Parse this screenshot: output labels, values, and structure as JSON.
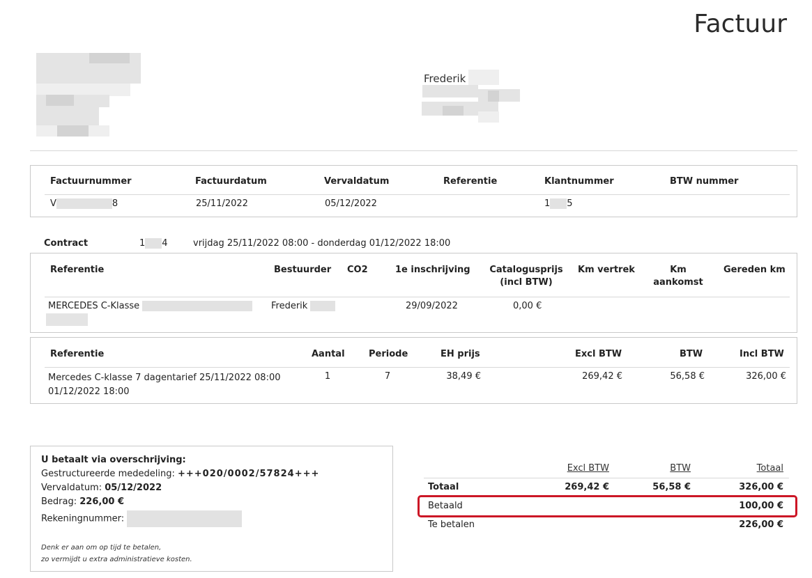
{
  "document": {
    "title": "Factuur"
  },
  "recipient": {
    "first_name": "Frederik"
  },
  "invoice_meta": {
    "headers": [
      "Factuurnummer",
      "Factuurdatum",
      "Vervaldatum",
      "Referentie",
      "Klantnummer",
      "BTW nummer"
    ],
    "factuurnummer_start": "V",
    "factuurnummer_end": "8",
    "factuurdatum": "25/11/2022",
    "vervaldatum": "05/12/2022",
    "klantnummer_start": "1",
    "klantnummer_end": "5"
  },
  "contract": {
    "label": "Contract",
    "number_start": "1",
    "number_end": "4",
    "period": "vrijdag 25/11/2022 08:00 - donderdag 01/12/2022 18:00"
  },
  "vehicle_table": {
    "headers": {
      "referentie": "Referentie",
      "bestuurder": "Bestuurder",
      "co2": "CO2",
      "inschrijving": "1e inschrijving",
      "catalogusprijs_1": "Catalogusprijs",
      "catalogusprijs_2": "(incl BTW)",
      "km_vertrek": "Km vertrek",
      "km_aankomst_1": "Km",
      "km_aankomst_2": "aankomst",
      "gereden_km": "Gereden km"
    },
    "row": {
      "referentie": "MERCEDES C-Klasse",
      "bestuurder": "Frederik",
      "inschrijving": "29/09/2022",
      "catalogusprijs": "0,00 €"
    }
  },
  "lines_table": {
    "headers": {
      "referentie": "Referentie",
      "aantal": "Aantal",
      "periode": "Periode",
      "eh_prijs": "EH prijs",
      "excl_btw": "Excl BTW",
      "btw": "BTW",
      "incl_btw": "Incl BTW"
    },
    "row": {
      "description_1": "Mercedes C-klasse 7 dagentarief 25/11/2022 08:00",
      "description_2": "01/12/2022 18:00",
      "aantal": "1",
      "periode": "7",
      "eh_prijs": "38,49 €",
      "excl_btw": "269,42 €",
      "btw": "56,58 €",
      "incl_btw": "326,00 €"
    }
  },
  "payment": {
    "title": "U betaalt via overschrijving:",
    "mededeling_label": "Gestructureerde mededeling:",
    "mededeling_value": "+++020/0002/57824+++",
    "vervaldatum_label": "Vervaldatum:",
    "vervaldatum_value": "05/12/2022",
    "bedrag_label": "Bedrag:",
    "bedrag_value": "226,00 €",
    "rekening_label": "Rekeningnummer:",
    "note_1": "Denk er aan om op tijd te betalen,",
    "note_2": "zo vermijdt u extra administratieve kosten."
  },
  "totals": {
    "headers": {
      "excl_btw": "Excl BTW",
      "btw": "BTW",
      "totaal": "Totaal"
    },
    "totaal": {
      "label": "Totaal",
      "excl_btw": "269,42 €",
      "btw": "56,58 €",
      "totaal": "326,00 €"
    },
    "betaald": {
      "label": "Betaald",
      "totaal": "100,00 €"
    },
    "te_betalen": {
      "label": "Te betalen",
      "totaal": "226,00 €"
    }
  },
  "colors": {
    "highlight": "#cc1626",
    "border": "#c9c9c9",
    "redacted": "#e2e2e2"
  }
}
